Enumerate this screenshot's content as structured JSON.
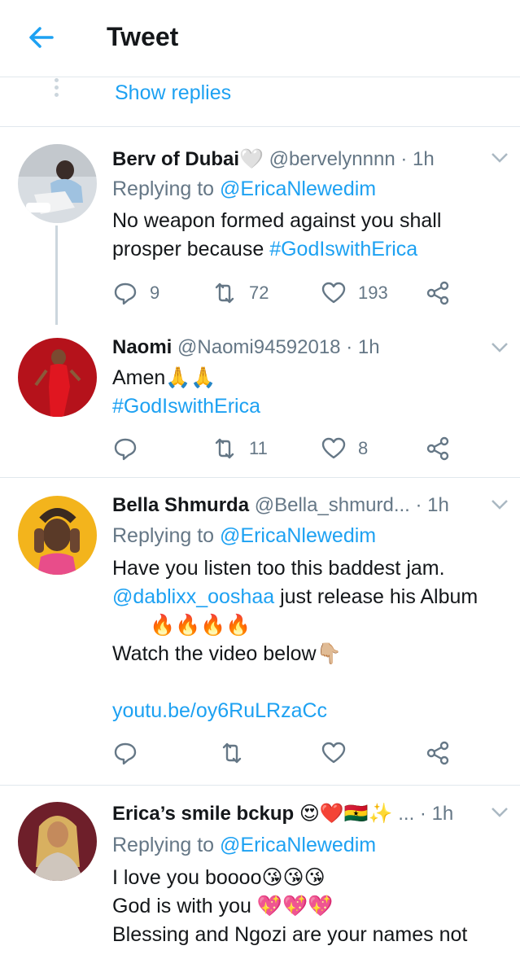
{
  "header": {
    "title": "Tweet"
  },
  "show_replies": "Show replies",
  "tweets": [
    {
      "name": "Berv of Dubai🤍",
      "handle": "@bervelynnnn · 1h",
      "replying_prefix": "Replying to ",
      "replying_to": "@EricaNlewedim",
      "line1": "No weapon formed against you shall",
      "line2_text": "prosper because ",
      "line2_tag": "#GodIswithErica",
      "replies": "9",
      "retweets": "72",
      "likes": "193"
    },
    {
      "name": "Naomi",
      "handle": "@Naomi94592018 · 1h",
      "line1": "Amen🙏🙏",
      "line2_tag": "#GodIswithErica",
      "replies": "",
      "retweets": "11",
      "likes": "8"
    },
    {
      "name": "Bella Shmurda",
      "handle": "@Bella_shmurd...",
      "time": "· 1h",
      "replying_prefix": "Replying to ",
      "replying_to": "@EricaNlewedim",
      "line1": "Have you listen too this baddest jam.",
      "line2_mention": "@dablixx_ooshaa",
      "line2_text": " just release his Album",
      "line3": "🔥🔥🔥🔥",
      "line4": "Watch the video below👇🏼",
      "link": "youtu.be/oy6RuLRzaCc"
    },
    {
      "name": "Erica’s smile bckup 😍❤️🇬🇭✨",
      "handle": "...",
      "time": "· 1h",
      "replying_prefix": "Replying to ",
      "replying_to": "@EricaNlewedim",
      "line1": "I love you boooo😘😘😘",
      "line2": "God is with you 💖💖💖",
      "line3": "Blessing and Ngozi are your names not"
    }
  ],
  "colors": {
    "accent": "#1da1f2",
    "muted": "#657786",
    "divider": "#e1e8ed"
  }
}
